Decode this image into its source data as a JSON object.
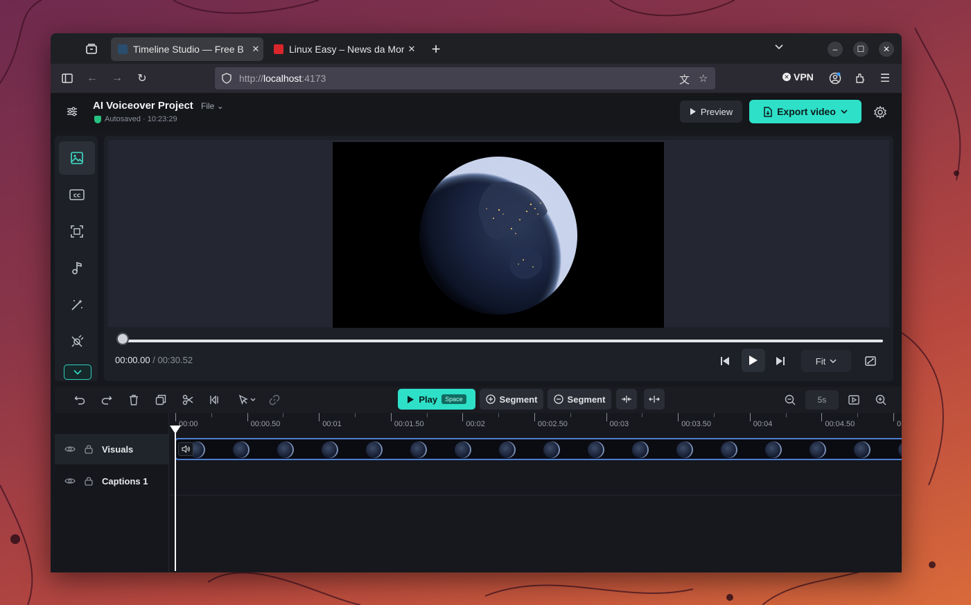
{
  "browser": {
    "tabs": [
      {
        "title": "Timeline Studio — Free B",
        "favicon": "app-favicon",
        "active": true
      },
      {
        "title": "Linux Easy – News da Mor",
        "favicon": "linux-easy-favicon",
        "active": false
      }
    ],
    "url": {
      "scheme": "http://",
      "host": "localhost",
      "port": ":4173"
    },
    "vpn_label": "VPN"
  },
  "header": {
    "project_title": "AI Voiceover Project",
    "file_menu": "File",
    "autosave_text": "Autosaved · 10:23:29",
    "preview_label": "Preview",
    "export_label": "Export video"
  },
  "player": {
    "current_time": "00:00.00",
    "total_time": "/ 00:30.52",
    "fit_label": "Fit",
    "progress": 0
  },
  "timeline": {
    "play_label": "Play",
    "play_shortcut": "Space",
    "add_segment_label": "Segment",
    "remove_segment_label": "Segment",
    "zoom_value": "5s",
    "ruler_labels": [
      "00:00",
      "00:00.50",
      "00:01",
      "00:01.50",
      "00:02",
      "00:02.50",
      "00:03",
      "00:03.50",
      "00:04",
      "00:04.50",
      "0"
    ],
    "tracks": [
      {
        "name": "Visuals"
      },
      {
        "name": "Captions 1"
      }
    ]
  },
  "colors": {
    "accent": "#2ee0c8",
    "track_border": "#4f7fd1"
  }
}
